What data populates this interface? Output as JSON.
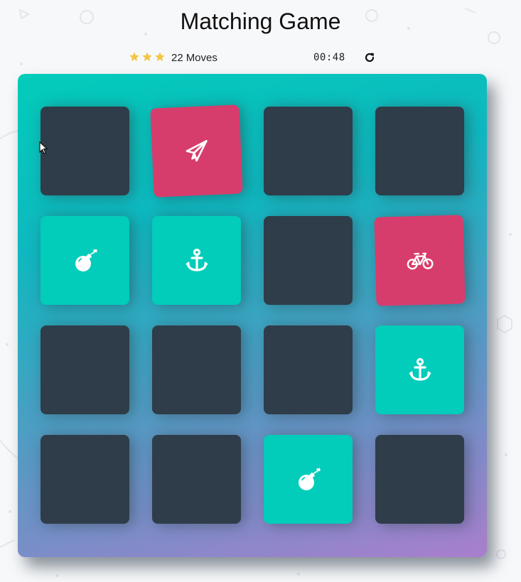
{
  "title": "Matching Game",
  "score_panel": {
    "stars": 3,
    "moves_count": "22",
    "moves_label": "Moves",
    "timer": "00:48",
    "restart_icon": "redo-icon"
  },
  "colors": {
    "card_hidden": "#2e3d49",
    "card_match": "#02ccba",
    "card_open": "#d73d6c",
    "star": "#f4c542"
  },
  "deck": {
    "cards": [
      {
        "icon": "",
        "state": "hidden"
      },
      {
        "icon": "paper-plane-icon",
        "state": "open"
      },
      {
        "icon": "",
        "state": "hidden"
      },
      {
        "icon": "",
        "state": "hidden"
      },
      {
        "icon": "bomb-icon",
        "state": "match"
      },
      {
        "icon": "anchor-icon",
        "state": "match"
      },
      {
        "icon": "",
        "state": "hidden"
      },
      {
        "icon": "bicycle-icon",
        "state": "open"
      },
      {
        "icon": "",
        "state": "hidden"
      },
      {
        "icon": "",
        "state": "hidden"
      },
      {
        "icon": "",
        "state": "hidden"
      },
      {
        "icon": "anchor-icon",
        "state": "match"
      },
      {
        "icon": "",
        "state": "hidden"
      },
      {
        "icon": "",
        "state": "hidden"
      },
      {
        "icon": "bomb-icon",
        "state": "match"
      },
      {
        "icon": "",
        "state": "hidden"
      }
    ]
  }
}
